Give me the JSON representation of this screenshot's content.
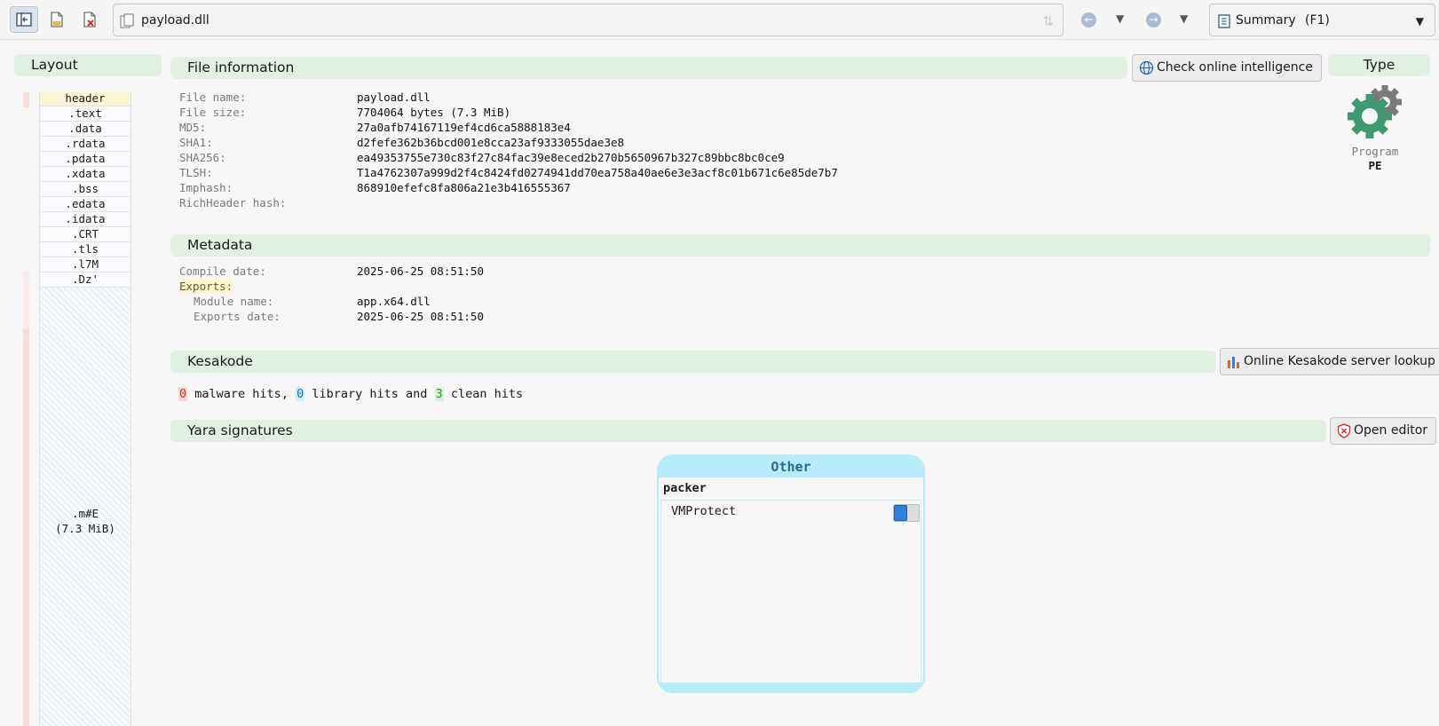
{
  "toolbar": {
    "path": "payload.dll",
    "view": {
      "label": "Summary",
      "shortcut": "(F1)"
    }
  },
  "layout": {
    "title": "Layout",
    "sections": [
      "header",
      ".text",
      ".data",
      ".rdata",
      ".pdata",
      ".xdata",
      ".bss",
      ".edata",
      ".idata",
      ".CRT",
      ".tls",
      ".l7M",
      ".Dz'"
    ],
    "big_section": {
      "name": ".m#E",
      "size": "(7.3 MiB)"
    }
  },
  "file_info": {
    "title": "File information",
    "button": "Check online intelligence",
    "rows": [
      {
        "key": "File name:",
        "value": "payload.dll"
      },
      {
        "key": "File size:",
        "value": "7704064 bytes (7.3 MiB)"
      },
      {
        "key": "MD5:",
        "value": "27a0afb74167119ef4cd6ca5888183e4"
      },
      {
        "key": "SHA1:",
        "value": "d2fefe362b36bcd001e8cca23af9333055dae3e8"
      },
      {
        "key": "SHA256:",
        "value": "ea49353755e730c83f27c84fac39e8eced2b270b5650967b327c89bbc8bc0ce9"
      },
      {
        "key": "TLSH:",
        "value": "T1a4762307a999d2f4c8424fd0274941dd70ea758a40ae6e3e3acf8c01b671c6e85de7b7"
      },
      {
        "key": "Imphash:",
        "value": "868910efefc8fa806a21e3b416555367"
      },
      {
        "key": "RichHeader hash:",
        "value": ""
      }
    ]
  },
  "type": {
    "title": "Type",
    "name": "Program",
    "format": "PE",
    "icon": "gear-icon"
  },
  "metadata": {
    "title": "Metadata",
    "compile_key": "Compile date:",
    "compile_value": "2025-06-25 08:51:50",
    "exports_label": "Exports:",
    "module_key": "Module name:",
    "module_value": "app.x64.dll",
    "exports_date_key": "Exports date:",
    "exports_date_value": "2025-06-25 08:51:50"
  },
  "kesakode": {
    "title": "Kesakode",
    "button": "Online Kesakode server lookup",
    "malware": "0",
    "malware_text": "malware hits,",
    "library": "0",
    "library_text": "library hits and",
    "clean": "3",
    "clean_text": "clean hits"
  },
  "yara": {
    "title": "Yara signatures",
    "button": "Open editor",
    "card": {
      "title": "Other",
      "category": "packer",
      "rule": "VMProtect"
    }
  },
  "colors": {
    "section_bar": "#e2efe3",
    "card_accent": "#b6ebf9",
    "toggle_on": "#2f7fdd",
    "malware": "#c0392b",
    "library": "#1479a8",
    "clean": "#2e8b3a"
  }
}
